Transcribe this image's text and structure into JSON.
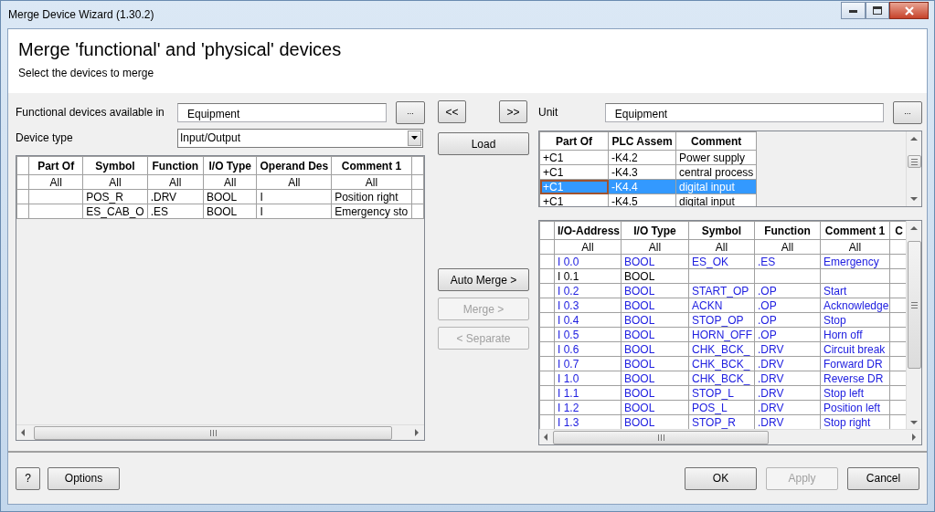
{
  "window": {
    "title": "Merge Device Wizard (1.30.2)"
  },
  "header": {
    "title": "Merge 'functional' and 'physical' devices",
    "subtitle": "Select the devices to merge"
  },
  "functional": {
    "source_label": "Functional devices available in",
    "source_value": "Equipment",
    "browse_button": "...",
    "type_label": "Device type",
    "type_value": "Input/Output",
    "table": {
      "columns": [
        "Part Of",
        "Symbol",
        "Function",
        "I/O Type",
        "Operand Des",
        "Comment 1"
      ],
      "filter_row": [
        "All",
        "All",
        "All",
        "All",
        "All",
        "All"
      ],
      "rows": [
        [
          "",
          "POS_R",
          ".DRV",
          "BOOL",
          "I",
          "Position right"
        ],
        [
          "",
          "ES_CAB_O",
          ".ES",
          "BOOL",
          "I",
          "Emergency sto"
        ]
      ]
    }
  },
  "middle_buttons": [
    {
      "label": "<<",
      "kind": "nav",
      "disabled": false
    },
    {
      "label": ">>",
      "kind": "nav",
      "disabled": false
    },
    {
      "label": "Load",
      "kind": "load",
      "disabled": false
    },
    {
      "label": "Auto Merge >",
      "kind": "merge",
      "disabled": false
    },
    {
      "label": "Merge >",
      "kind": "merge",
      "disabled": true
    },
    {
      "label": "< Separate",
      "kind": "merge",
      "disabled": true
    }
  ],
  "physical": {
    "unit_label": "Unit",
    "unit_value": "Equipment",
    "browse_button": "...",
    "assemblies": {
      "columns": [
        "Part Of",
        "PLC Assem",
        "Comment"
      ],
      "rows": [
        {
          "cells": [
            "+C1",
            "-K4.2",
            "Power supply"
          ],
          "selected": false
        },
        {
          "cells": [
            "+C1",
            "-K4.3",
            "central process"
          ],
          "selected": false
        },
        {
          "cells": [
            "+C1",
            "-K4.4",
            "digital input"
          ],
          "selected": true
        },
        {
          "cells": [
            "+C1",
            "-K4.5",
            "digital input"
          ],
          "selected": false
        }
      ]
    },
    "io_table": {
      "columns": [
        "I/O-Address",
        "I/O Type",
        "Symbol",
        "Function",
        "Comment 1",
        "C"
      ],
      "filter_row": [
        "All",
        "All",
        "All",
        "All",
        "All"
      ],
      "rows": [
        {
          "cells": [
            "I 0.0",
            "BOOL",
            "ES_OK",
            ".ES",
            "Emergency",
            ""
          ],
          "assigned": true
        },
        {
          "cells": [
            "I 0.1",
            "BOOL",
            "",
            "",
            "",
            ""
          ],
          "assigned": false
        },
        {
          "cells": [
            "I 0.2",
            "BOOL",
            "START_OP",
            ".OP",
            "Start",
            ""
          ],
          "assigned": true
        },
        {
          "cells": [
            "I 0.3",
            "BOOL",
            "ACKN",
            ".OP",
            "Acknowledge",
            ""
          ],
          "assigned": true
        },
        {
          "cells": [
            "I 0.4",
            "BOOL",
            "STOP_OP",
            ".OP",
            "Stop",
            ""
          ],
          "assigned": true
        },
        {
          "cells": [
            "I 0.5",
            "BOOL",
            "HORN_OFF",
            ".OP",
            "Horn off",
            ""
          ],
          "assigned": true
        },
        {
          "cells": [
            "I 0.6",
            "BOOL",
            "CHK_BCK_",
            ".DRV",
            "Circuit break",
            ""
          ],
          "assigned": true
        },
        {
          "cells": [
            "I 0.7",
            "BOOL",
            "CHK_BCK_",
            ".DRV",
            "Forward DR",
            ""
          ],
          "assigned": true
        },
        {
          "cells": [
            "I 1.0",
            "BOOL",
            "CHK_BCK_",
            ".DRV",
            "Reverse DR",
            ""
          ],
          "assigned": true
        },
        {
          "cells": [
            "I 1.1",
            "BOOL",
            "STOP_L",
            ".DRV",
            "Stop left",
            ""
          ],
          "assigned": true
        },
        {
          "cells": [
            "I 1.2",
            "BOOL",
            "POS_L",
            ".DRV",
            "Position left",
            ""
          ],
          "assigned": true
        },
        {
          "cells": [
            "I 1.3",
            "BOOL",
            "STOP_R",
            ".DRV",
            "Stop right",
            ""
          ],
          "assigned": true
        }
      ]
    }
  },
  "footer": {
    "buttons": [
      {
        "label": "?",
        "kind": "left",
        "disabled": false
      },
      {
        "label": "Options",
        "kind": "left",
        "disabled": false
      },
      {
        "label": "OK",
        "kind": "right",
        "disabled": false
      },
      {
        "label": "Apply",
        "kind": "right",
        "disabled": true
      },
      {
        "label": "Cancel",
        "kind": "right",
        "disabled": false
      }
    ]
  }
}
